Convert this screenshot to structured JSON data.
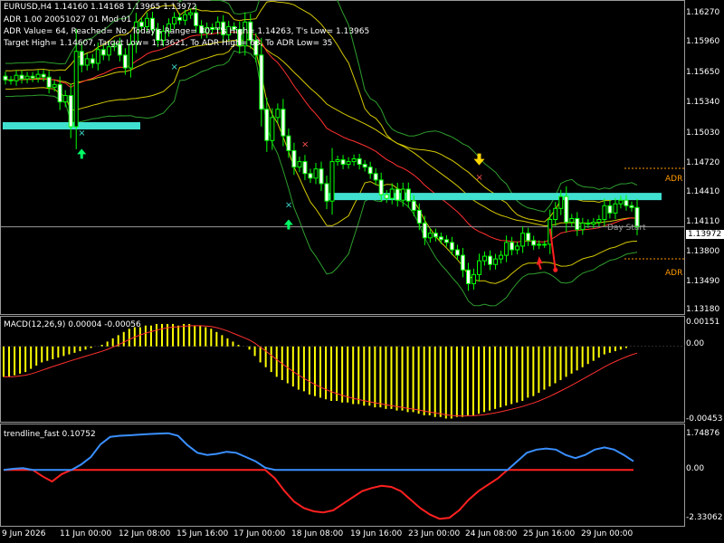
{
  "header": {
    "symbol_line": "EURUSD,H4  1.14160 1.14168 1.13965 1.13972",
    "adr_line": "ADR 1.00 20051027 01 Mod 01",
    "adr_values": "ADR Value= 64, Reached= No, Today's Range= 30, T's High= 1.14263, T's Low= 1.13965",
    "targets": "Target High= 1.14607, Target Low= 1.13621, To ADR High= 63, To ADR Low= 35"
  },
  "current_price": "1.13972",
  "price_axis": [
    "1.16270",
    "1.15960",
    "1.15650",
    "1.15340",
    "1.15030",
    "1.14720",
    "1.14410",
    "1.14110",
    "1.13800",
    "1.13490",
    "1.13180"
  ],
  "macd": {
    "label": "MACD(12,26,9) 0.00004 -0.00056",
    "axis": [
      "0.00151",
      "0.00",
      "-0.00453"
    ]
  },
  "trendline": {
    "label": "trendline_fast 0.10752",
    "axis": [
      "1.74876",
      "0.00",
      "-2.33062"
    ]
  },
  "chart_labels": {
    "adr_high": "ADR",
    "adr_low": "ADR",
    "day_start": "Day Start"
  },
  "time_axis": [
    "9 Jun 2026",
    "11 Jun 00:00",
    "12 Jun 08:00",
    "15 Jun 16:00",
    "17 Jun 00:00",
    "18 Jun 08:00",
    "19 Jun 16:00",
    "23 Jun 00:00",
    "24 Jun 08:00",
    "25 Jun 16:00",
    "29 Jun 00:00"
  ],
  "colors": {
    "bg": "#000000",
    "candle": "#00ff00",
    "bull_body": "#000000",
    "bear_body": "#ffffff",
    "support_zone": "#40e0d0",
    "macd_hist": "#ffff00",
    "signal": "#ff3030",
    "trend_up": "#3a8fff",
    "trend_down": "#ff2020",
    "band_yellow": "#d4c800",
    "band_green": "#2e9e2e",
    "adr_line": "#ff9900"
  },
  "chart_data": [
    {
      "type": "candlestick",
      "title": "EURUSD,H4",
      "ylim": [
        1.1303,
        1.1642
      ],
      "close": [
        1.1557,
        1.1556,
        1.1562,
        1.1558,
        1.1561,
        1.1559,
        1.1563,
        1.156,
        1.1549,
        1.1552,
        1.1533,
        1.154,
        1.1506,
        1.1588,
        1.1573,
        1.158,
        1.1575,
        1.159,
        1.1584,
        1.1593,
        1.1596,
        1.1584,
        1.157,
        1.1596,
        1.162,
        1.1615,
        1.1624,
        1.1612,
        1.16,
        1.161,
        1.1618,
        1.1625,
        1.1622,
        1.1628,
        1.163,
        1.1616,
        1.1608,
        1.1614,
        1.1612,
        1.162,
        1.1606,
        1.1615,
        1.1612,
        1.1594,
        1.162,
        1.16,
        1.1584,
        1.1525,
        1.1491,
        1.1516,
        1.1525,
        1.1496,
        1.148,
        1.1462,
        1.1468,
        1.1455,
        1.145,
        1.146,
        1.1444,
        1.1425,
        1.1468,
        1.147,
        1.1465,
        1.1468,
        1.1471,
        1.1465,
        1.1462,
        1.1455,
        1.1448,
        1.1432,
        1.1428,
        1.1438,
        1.1426,
        1.1438,
        1.1425,
        1.1415,
        1.1401,
        1.1385,
        1.139,
        1.1386,
        1.1383,
        1.138,
        1.1372,
        1.1366,
        1.135,
        1.1335,
        1.1345,
        1.136,
        1.1365,
        1.1356,
        1.1362,
        1.1366,
        1.138,
        1.1372,
        1.1376,
        1.139,
        1.1382,
        1.1377,
        1.1378,
        1.1378,
        1.1405,
        1.1417,
        1.143,
        1.1402,
        1.1406,
        1.1394,
        1.1401,
        1.14,
        1.1402,
        1.1405,
        1.142,
        1.1412,
        1.1422,
        1.1426,
        1.142,
        1.1418,
        1.1397
      ],
      "series": [
        {
          "name": "MACD(12,26,9)",
          "values": [
            -0.0019,
            -0.0019,
            -0.0018,
            -0.0017,
            -0.0016,
            -0.0014,
            -0.0012,
            -0.001,
            -0.0009,
            -0.0008,
            -0.0007,
            -0.0006,
            -0.0005,
            -0.0004,
            -0.0003,
            -0.0002,
            -0.0001,
            0.0,
            0.0001,
            0.0003,
            0.0005,
            0.0007,
            0.0009,
            0.0011,
            0.0012,
            0.0012,
            0.0013,
            0.0013,
            0.0014,
            0.0014,
            0.0014,
            0.0014,
            0.0013,
            0.0014,
            0.0014,
            0.0013,
            0.0013,
            0.0012,
            0.0011,
            0.0009,
            0.0007,
            0.0005,
            0.0003,
            0.0001,
            0.0,
            -0.0002,
            -0.0006,
            -0.001,
            -0.0013,
            -0.0016,
            -0.0019,
            -0.0021,
            -0.0023,
            -0.0025,
            -0.0027,
            -0.0028,
            -0.003,
            -0.0031,
            -0.0032,
            -0.0033,
            -0.0034,
            -0.0034,
            -0.0035,
            -0.0035,
            -0.0036,
            -0.0036,
            -0.0037,
            -0.0037,
            -0.0038,
            -0.0038,
            -0.0039,
            -0.0039,
            -0.004,
            -0.004,
            -0.0041,
            -0.0041,
            -0.0042,
            -0.0043,
            -0.0043,
            -0.0044,
            -0.0044,
            -0.0045,
            -0.0045,
            -0.0044,
            -0.0044,
            -0.0043,
            -0.0043,
            -0.0042,
            -0.0041,
            -0.004,
            -0.0039,
            -0.0038,
            -0.0037,
            -0.0036,
            -0.0035,
            -0.0034,
            -0.0032,
            -0.0031,
            -0.0029,
            -0.0027,
            -0.0025,
            -0.0023,
            -0.0021,
            -0.0019,
            -0.0017,
            -0.0015,
            -0.0013,
            -0.0011,
            -0.0009,
            -0.0007,
            -0.0005,
            -0.0004,
            -0.0003,
            -0.0002,
            -0.0001,
            0.0,
            0.0
          ]
        },
        {
          "name": "trendline_fast",
          "values": [
            0.0,
            0.05,
            0.08,
            0.0,
            -0.3,
            -0.55,
            -0.2,
            0.0,
            0.25,
            0.6,
            1.2,
            1.55,
            1.6,
            1.62,
            1.65,
            1.68,
            1.7,
            1.72,
            1.6,
            1.15,
            0.8,
            0.7,
            0.75,
            0.85,
            0.8,
            0.6,
            0.4,
            0.1,
            -0.4,
            -1.0,
            -1.5,
            -1.8,
            -1.95,
            -2.0,
            -1.9,
            -1.6,
            -1.3,
            -1.0,
            -0.85,
            -0.75,
            -0.8,
            -1.0,
            -1.4,
            -1.8,
            -2.1,
            -2.3,
            -2.25,
            -1.9,
            -1.4,
            -1.0,
            -0.7,
            -0.4,
            0.0,
            0.4,
            0.8,
            0.95,
            1.0,
            0.95,
            0.7,
            0.55,
            0.7,
            0.95,
            1.05,
            0.95,
            0.7,
            0.4
          ]
        }
      ]
    }
  ]
}
